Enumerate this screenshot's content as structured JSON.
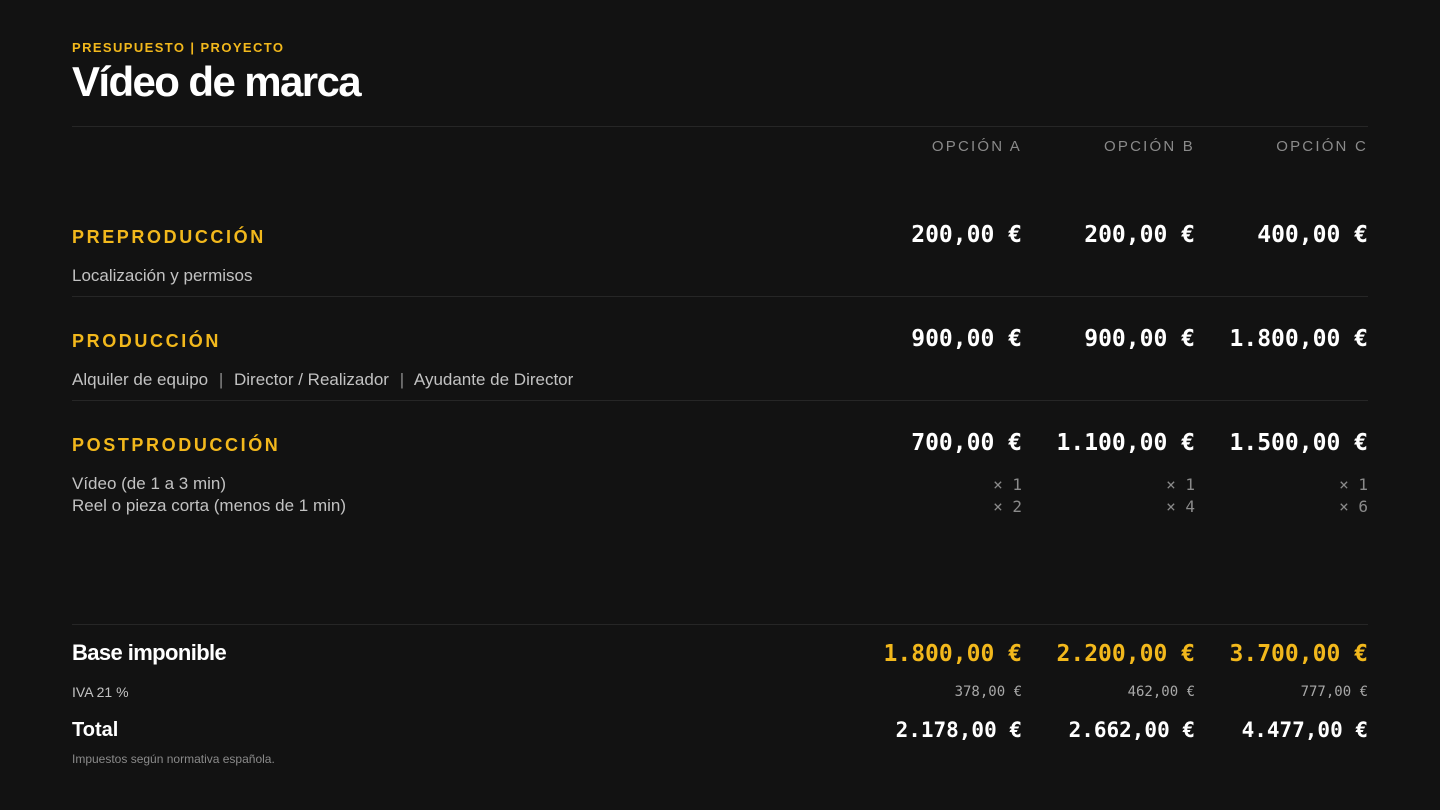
{
  "header": {
    "eyebrow": "PRESUPUESTO | PROYECTO",
    "title": "Vídeo de marca"
  },
  "options": [
    "OPCIÓN A",
    "OPCIÓN B",
    "OPCIÓN C"
  ],
  "sections": [
    {
      "title": "PREPRODUCCIÓN",
      "items": [
        "Localización y permisos"
      ],
      "prices": [
        "200,00 €",
        "200,00 €",
        "400,00 €"
      ]
    },
    {
      "title": "PRODUCCIÓN",
      "items": [
        "Alquiler de equipo",
        "Director / Realizador",
        "Ayudante de Director"
      ],
      "separator": "|",
      "prices": [
        "900,00 €",
        "900,00 €",
        "1.800,00 €"
      ]
    },
    {
      "title": "POSTPRODUCCIÓN",
      "items": [
        "Vídeo (de 1 a 3 min)",
        "Reel o pieza corta (menos de 1 min)"
      ],
      "prices": [
        "700,00 €",
        "1.100,00 €",
        "1.500,00 €"
      ],
      "quantities": [
        [
          "× 1",
          "× 1",
          "× 1"
        ],
        [
          "× 2",
          "× 4",
          "× 6"
        ]
      ]
    }
  ],
  "summary": {
    "base_label": "Base imponible",
    "base_values": [
      "1.800,00 €",
      "2.200,00 €",
      "3.700,00 €"
    ],
    "iva_label": "IVA 21 %",
    "iva_values": [
      "378,00 €",
      "462,00 €",
      "777,00 €"
    ],
    "total_label": "Total",
    "total_values": [
      "2.178,00 €",
      "2.662,00 €",
      "4.477,00 €"
    ],
    "note": "Impuestos según normativa española."
  },
  "colors": {
    "background": "#121212",
    "accent": "#f2b81c",
    "text": "#ffffff",
    "muted": "#8a8a8a"
  }
}
